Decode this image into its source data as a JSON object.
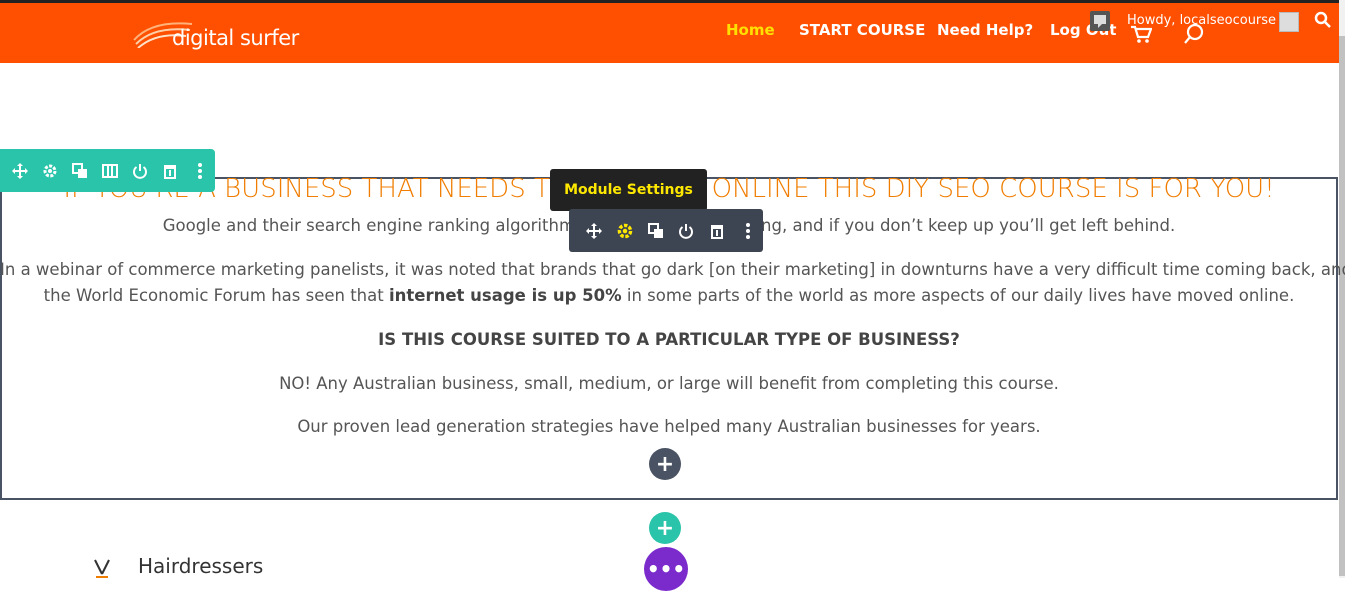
{
  "header": {
    "logo_text": "digital surfer",
    "nav": [
      "Home",
      "START COURSE",
      "Need Help?",
      "Log Out"
    ],
    "admin_greeting": "Howdy, localseocourse",
    "brand_color": "#ff4f00",
    "active_color": "#ffe000"
  },
  "builder": {
    "row_toolbar_icons": [
      "move-icon",
      "settings-icon",
      "duplicate-icon",
      "columns-icon",
      "power-icon",
      "trash-icon",
      "more-icon"
    ],
    "module_toolbar_icons": [
      "move-icon",
      "settings-icon",
      "duplicate-icon",
      "power-icon",
      "trash-icon",
      "more-icon"
    ],
    "tooltip": "Module Settings",
    "add_label": "+",
    "more_label": "•••"
  },
  "content": {
    "heading": "IF YOU'RE A BUSINESS THAT NEEDS TO SUCCEED ONLINE THIS DIY SEO COURSE IS FOR YOU!",
    "p1": "Google and their search engine ranking algorithms are constantly evolving, and if you don’t keep up you’ll get left behind.",
    "p2_line1": "In a webinar of commerce marketing panelists, it was noted that brands that go dark [on their marketing] in downturns have a very difficult time coming back, and",
    "p2_line2_pre": "the World Economic Forum has seen that ",
    "p2_line2_bold": "internet usage is up 50%",
    "p2_line2_post": " in some parts of the world as more aspects of our daily lives have moved online.",
    "subheading": "IS THIS COURSE SUITED TO A PARTICULAR TYPE OF BUSINESS?",
    "p3": "NO! Any Australian business, small, medium, or large will benefit from completing this course.",
    "p4": "Our proven lead generation strategies have helped many Australian businesses for years.",
    "heading_color": "#f07d00"
  },
  "next_section": {
    "item_label": "Hairdressers"
  }
}
